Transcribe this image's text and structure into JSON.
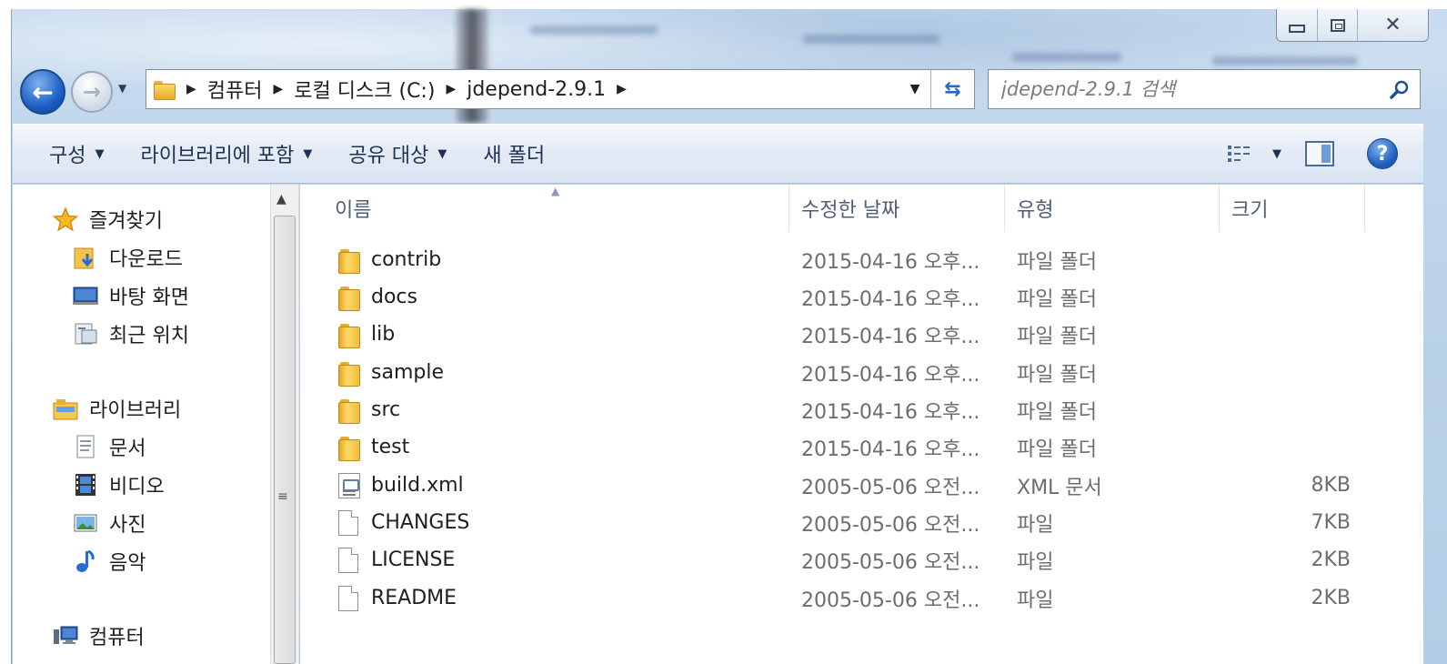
{
  "window": {
    "caption_buttons": [
      "minimize",
      "maximize",
      "close"
    ]
  },
  "address": {
    "crumbs": [
      "컴퓨터",
      "로컬 디스크 (C:)",
      "jdepend-2.9.1"
    ]
  },
  "search": {
    "placeholder": "jdepend-2.9.1 검색"
  },
  "toolbar": {
    "organize": "구성",
    "include_in_library": "라이브러리에 포함",
    "share_with": "공유 대상",
    "new_folder": "새 폴더"
  },
  "nav": {
    "favorites": "즐겨찾기",
    "downloads": "다운로드",
    "desktop": "바탕 화면",
    "recent": "최근 위치",
    "libraries": "라이브러리",
    "documents": "문서",
    "videos": "비디오",
    "pictures": "사진",
    "music": "음악",
    "computer": "컴퓨터"
  },
  "columns": {
    "name": "이름",
    "modified": "수정한 날짜",
    "type": "유형",
    "size": "크기"
  },
  "files": [
    {
      "name": "contrib",
      "modified": "2015-04-16 오후...",
      "type": "파일 폴더",
      "size": "",
      "icon": "folder"
    },
    {
      "name": "docs",
      "modified": "2015-04-16 오후...",
      "type": "파일 폴더",
      "size": "",
      "icon": "folder"
    },
    {
      "name": "lib",
      "modified": "2015-04-16 오후...",
      "type": "파일 폴더",
      "size": "",
      "icon": "folder"
    },
    {
      "name": "sample",
      "modified": "2015-04-16 오후...",
      "type": "파일 폴더",
      "size": "",
      "icon": "folder"
    },
    {
      "name": "src",
      "modified": "2015-04-16 오후...",
      "type": "파일 폴더",
      "size": "",
      "icon": "folder"
    },
    {
      "name": "test",
      "modified": "2015-04-16 오후...",
      "type": "파일 폴더",
      "size": "",
      "icon": "folder"
    },
    {
      "name": "build.xml",
      "modified": "2005-05-06 오전...",
      "type": "XML 문서",
      "size": "8KB",
      "icon": "xml"
    },
    {
      "name": "CHANGES",
      "modified": "2005-05-06 오전...",
      "type": "파일",
      "size": "7KB",
      "icon": "doc"
    },
    {
      "name": "LICENSE",
      "modified": "2005-05-06 오전...",
      "type": "파일",
      "size": "2KB",
      "icon": "doc"
    },
    {
      "name": "README",
      "modified": "2005-05-06 오전...",
      "type": "파일",
      "size": "2KB",
      "icon": "doc"
    }
  ]
}
